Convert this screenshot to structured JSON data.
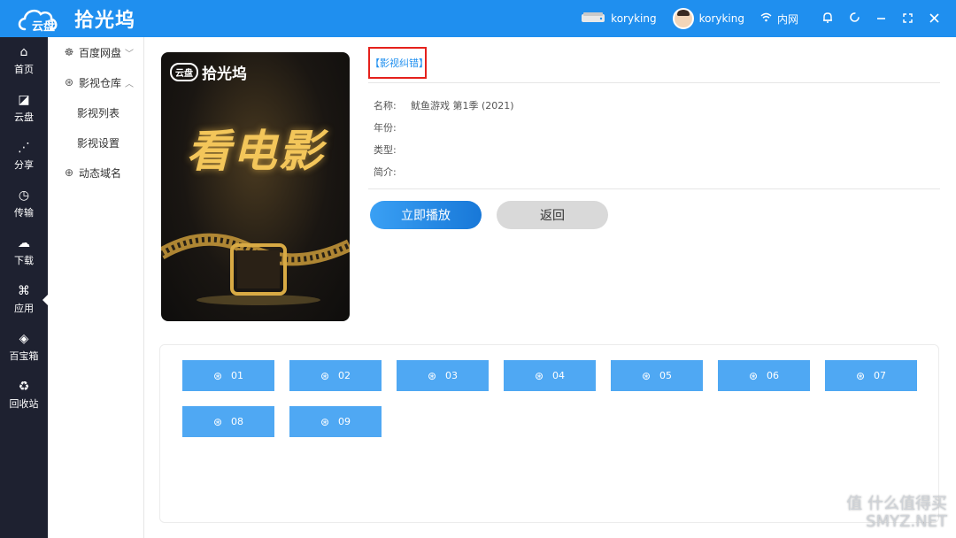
{
  "app": {
    "logo_cloud_text": "云盘",
    "name": "拾光坞"
  },
  "topbar": {
    "device_name": "koryking",
    "user_name": "koryking",
    "network_label": "内网",
    "icons": [
      "device-icon",
      "avatar",
      "wifi-icon",
      "bell-icon",
      "refresh-icon",
      "minimize-icon",
      "maximize-icon",
      "close-icon"
    ]
  },
  "leftnav": {
    "items": [
      {
        "label": "首页",
        "icon": "home-icon",
        "glyph": "⌂"
      },
      {
        "label": "云盘",
        "icon": "cloud-disk-icon",
        "glyph": "◪"
      },
      {
        "label": "分享",
        "icon": "share-icon",
        "glyph": "⋰"
      },
      {
        "label": "传输",
        "icon": "transfer-icon",
        "glyph": "◷"
      },
      {
        "label": "下载",
        "icon": "download-icon",
        "glyph": "☁"
      },
      {
        "label": "应用",
        "icon": "apps-icon",
        "glyph": "⌘"
      },
      {
        "label": "百宝箱",
        "icon": "toolbox-icon",
        "glyph": "◈"
      },
      {
        "label": "回收站",
        "icon": "recycle-icon",
        "glyph": "♻"
      }
    ],
    "active_index": 5
  },
  "subnav": {
    "items": [
      {
        "label": "百度网盘",
        "icon": "paw-icon",
        "glyph": "☸",
        "caret": "﹀"
      },
      {
        "label": "影视仓库",
        "icon": "film-reel-icon",
        "glyph": "⊛",
        "caret": "︿"
      },
      {
        "label": "影视列表"
      },
      {
        "label": "影视设置"
      },
      {
        "label": "动态域名",
        "icon": "globe-icon",
        "glyph": "⊕"
      }
    ]
  },
  "detail": {
    "fix_link": "【影视纠错】",
    "poster": {
      "logo_cloud": "云盘",
      "logo_name": "拾光坞",
      "title": "看电影"
    },
    "fields": [
      {
        "label": "名称:",
        "value": "鱿鱼游戏 第1季 (2021)"
      },
      {
        "label": "年份:",
        "value": ""
      },
      {
        "label": "类型:",
        "value": ""
      },
      {
        "label": "简介:",
        "value": ""
      }
    ],
    "play_button": "立即播放",
    "back_button": "返回"
  },
  "episodes": [
    "01",
    "02",
    "03",
    "04",
    "05",
    "06",
    "07",
    "08",
    "09"
  ],
  "watermark": {
    "line1": "值 什么值得买",
    "line2": "SMYZ.NET"
  },
  "colors": {
    "accent": "#1f8fef",
    "nav_bg": "#1e2130",
    "episode_bg": "#4fa8f3",
    "highlight_border": "#e5211c"
  }
}
